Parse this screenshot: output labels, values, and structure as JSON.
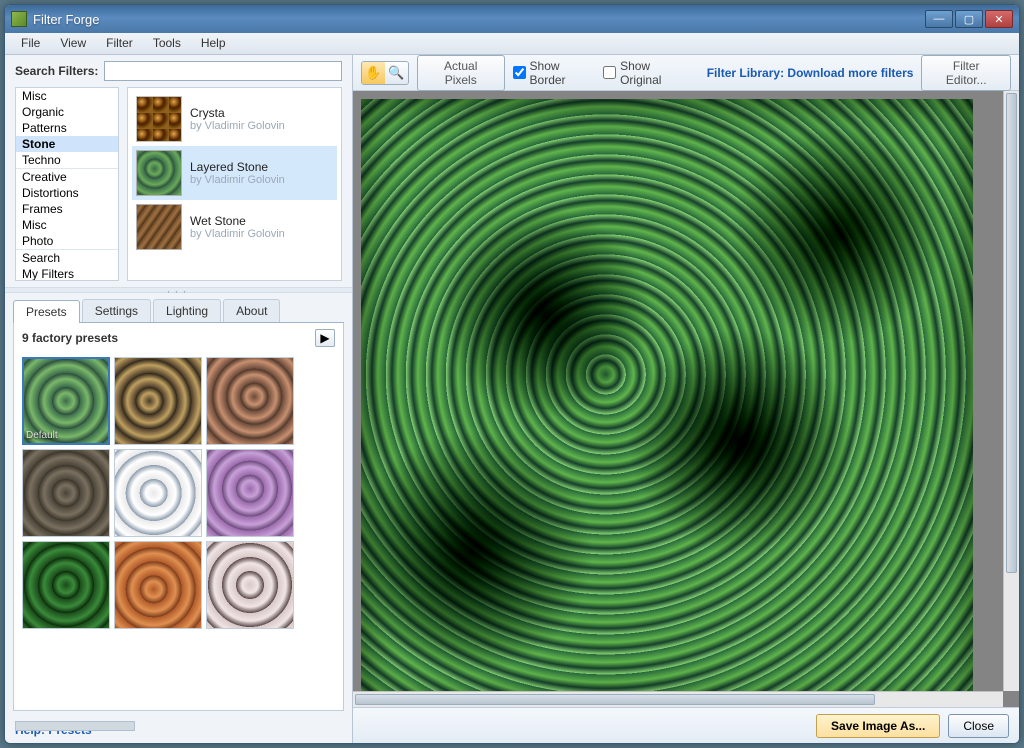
{
  "window": {
    "title": "Filter Forge"
  },
  "menu": [
    "File",
    "View",
    "Filter",
    "Tools",
    "Help"
  ],
  "search": {
    "label": "Search Filters:",
    "value": ""
  },
  "category_groups": [
    [
      "Misc",
      "Organic",
      "Patterns",
      "Stone",
      "Techno"
    ],
    [
      "Creative",
      "Distortions",
      "Frames",
      "Misc",
      "Photo"
    ],
    [
      "Search",
      "My Filters"
    ]
  ],
  "selected_category": "Stone",
  "filters": [
    {
      "name": "Crysta",
      "author": "by Vladimir Golovin",
      "tx": "tx-crysta"
    },
    {
      "name": "Layered Stone",
      "author": "by Vladimir Golovin",
      "tx": "tx-layered"
    },
    {
      "name": "Wet Stone",
      "author": "by Vladimir Golovin",
      "tx": "tx-wet"
    }
  ],
  "selected_filter": "Layered Stone",
  "tabs": [
    "Presets",
    "Settings",
    "Lighting",
    "About"
  ],
  "active_tab": "Presets",
  "presets": {
    "count_label": "9 factory presets",
    "default_label": "Default"
  },
  "preset_thumbs": [
    "tx-p1",
    "tx-p2",
    "tx-p3",
    "tx-p4",
    "tx-p5",
    "tx-p6",
    "tx-p7",
    "tx-p8",
    "tx-p9"
  ],
  "help_link": "Help: Presets",
  "toolbar": {
    "actual_pixels": "Actual Pixels",
    "show_border": "Show Border",
    "show_original": "Show Original",
    "library_link": "Filter Library: Download more filters",
    "filter_editor": "Filter Editor..."
  },
  "bottom": {
    "save_as": "Save Image As...",
    "close": "Close"
  }
}
